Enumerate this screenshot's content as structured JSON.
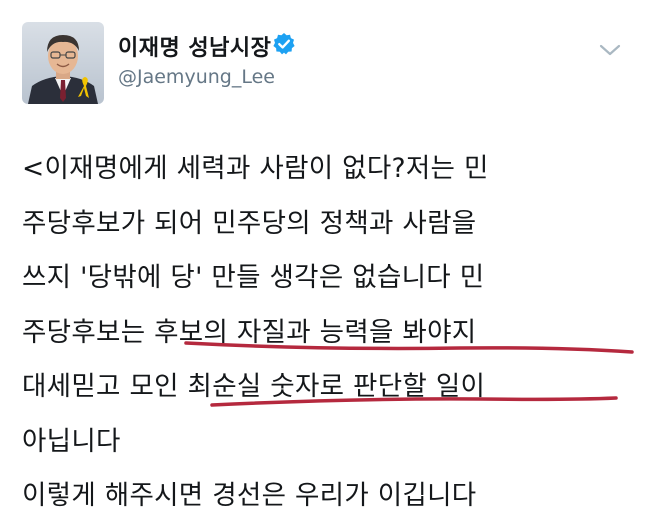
{
  "tweet": {
    "display_name": "이재명 성남시장",
    "handle": "@Jaemyung_Lee",
    "lines": [
      "<이재명에게 세력과 사람이 없다?저는 민",
      "주당후보가 되어 민주당의 정책과 사람을",
      "쓰지 '당밖에 당' 만들 생각은 없습니다 민",
      "주당후보는 후보의 자질과 능력을 봐야지",
      "대세믿고 모인 최순실 숫자로 판단할 일이",
      "아닙니다",
      "이렇게 해주시면 경선은 우리가 이깁니다"
    ]
  },
  "icons": {
    "verified": "verified-badge-icon",
    "menu": "chevron-down-icon",
    "ribbon": "yellow-ribbon-icon"
  },
  "colors": {
    "text": "#14171a",
    "muted": "#657786",
    "verified": "#1da1f2",
    "annotation": "#b5293e",
    "ribbon": "#f2c300"
  }
}
